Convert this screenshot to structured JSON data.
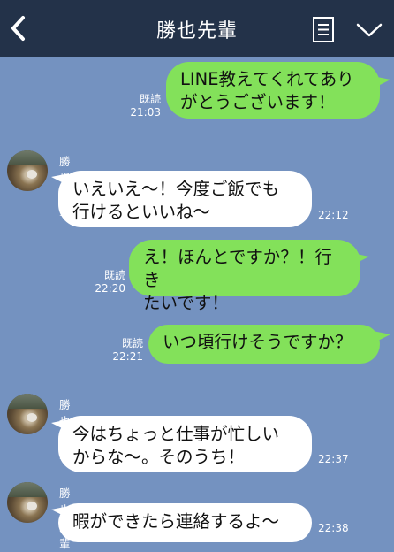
{
  "header": {
    "title": "勝也先輩",
    "back_icon": "chevron-left-icon",
    "menu_icon": "list-icon",
    "expand_icon": "chevron-down-icon"
  },
  "colors": {
    "header_bg": "#233249",
    "chat_bg": "#7492c0",
    "outgoing_bubble": "#83e15a",
    "incoming_bubble": "#ffffff"
  },
  "messages": [
    {
      "direction": "outgoing",
      "lines": [
        "LINE教えてくれてあり",
        "がとうございます！"
      ],
      "read": "既読",
      "time": "21:03"
    },
    {
      "direction": "incoming",
      "sender": "勝也先輩",
      "lines": [
        "いえいえ〜！今度ご飯でも",
        "行けるといいね〜"
      ],
      "time": "22:12"
    },
    {
      "direction": "outgoing",
      "lines": [
        "え！ほんとですか？！行き",
        "たいです！"
      ],
      "read": "既読",
      "time": "22:20"
    },
    {
      "direction": "outgoing",
      "lines": [
        "いつ頃行けそうですか？"
      ],
      "read": "既読",
      "time": "22:21"
    },
    {
      "direction": "incoming",
      "sender": "勝也先輩",
      "lines": [
        "今はちょっと仕事が忙しい",
        "からな〜。そのうち！"
      ],
      "time": "22:37"
    },
    {
      "direction": "incoming",
      "sender": "勝也先輩",
      "lines": [
        "暇ができたら連絡するよ〜"
      ],
      "time": "22:38"
    }
  ]
}
